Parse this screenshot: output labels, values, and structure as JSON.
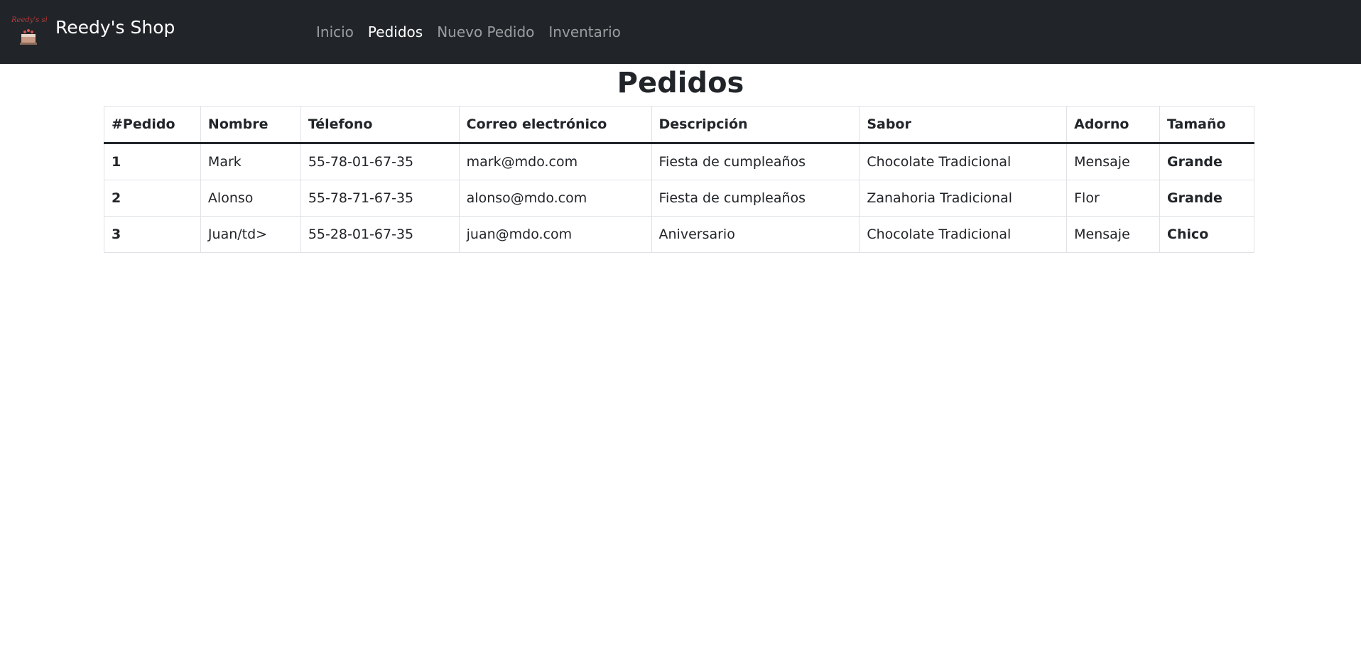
{
  "navbar": {
    "brand": "Reedy's Shop",
    "logo_icon": "cake-logo-icon",
    "logo_text": "Reedy's shop",
    "links": [
      {
        "label": "Inicio",
        "active": false
      },
      {
        "label": "Pedidos",
        "active": true
      },
      {
        "label": "Nuevo Pedido",
        "active": false
      },
      {
        "label": "Inventario",
        "active": false
      }
    ],
    "colors": {
      "background": "#212529",
      "active": "#ffffff",
      "inactive": "#8c8f93"
    }
  },
  "main": {
    "title": "Pedidos",
    "table": {
      "headers": [
        "#Pedido",
        "Nombre",
        "Télefono",
        "Correo electrónico",
        "Descripción",
        "Sabor",
        "Adorno",
        "Tamaño"
      ],
      "rows": [
        [
          "1",
          "Mark",
          "55-78-01-67-35",
          "mark@mdo.com",
          "Fiesta de cumpleaños",
          "Chocolate Tradicional",
          "Mensaje",
          "Grande"
        ],
        [
          "2",
          "Alonso",
          "55-78-71-67-35",
          "alonso@mdo.com",
          "Fiesta de cumpleaños",
          "Zanahoria Tradicional",
          "Flor",
          "Grande"
        ],
        [
          "3",
          "Juan/td>",
          "55-28-01-67-35",
          "juan@mdo.com",
          "Aniversario",
          "Chocolate Tradicional",
          "Mensaje",
          "Chico"
        ]
      ]
    }
  }
}
